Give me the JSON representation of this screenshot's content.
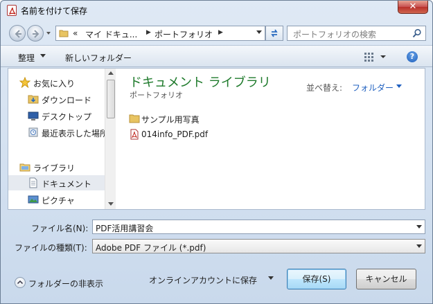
{
  "window": {
    "title": "名前を付けて保存",
    "close_label": "✕"
  },
  "address": {
    "prefix": "«",
    "parts": [
      "マイ ドキュ...",
      "ポートフォリオ"
    ],
    "search_placeholder": "ポートフォリオの検索"
  },
  "toolbar": {
    "organize_label": "整理",
    "new_folder_label": "新しいフォルダー"
  },
  "nav": {
    "items": [
      {
        "label": "お気に入り",
        "icon": "star-icon"
      },
      {
        "label": "ダウンロード",
        "icon": "downloads-icon"
      },
      {
        "label": "デスクトップ",
        "icon": "desktop-icon"
      },
      {
        "label": "最近表示した場所",
        "icon": "recent-places-icon"
      },
      {
        "label": "ライブラリ",
        "icon": "library-icon"
      },
      {
        "label": "ドキュメント",
        "icon": "documents-icon"
      },
      {
        "label": "ピクチャ",
        "icon": "pictures-icon"
      }
    ]
  },
  "main": {
    "library_title": "ドキュメント ライブラリ",
    "library_subtitle": "ポートフォリオ",
    "sort_label": "並べ替え:",
    "sort_value": "フォルダー",
    "files": [
      {
        "name": "サンプル用写真",
        "icon": "folder-icon"
      },
      {
        "name": "014info_PDF.pdf",
        "icon": "pdf-file-icon"
      }
    ]
  },
  "form": {
    "filename_label": "ファイル名(N):",
    "filename_value": "PDF活用講習会",
    "filetype_label": "ファイルの種類(T):",
    "filetype_value": "Adobe PDF ファイル (*.pdf)"
  },
  "footer": {
    "hide_folders_label": "フォルダーの非表示",
    "online_save_label": "オンラインアカウントに保存",
    "save_label": "保存(S)",
    "cancel_label": "キャンセル"
  }
}
